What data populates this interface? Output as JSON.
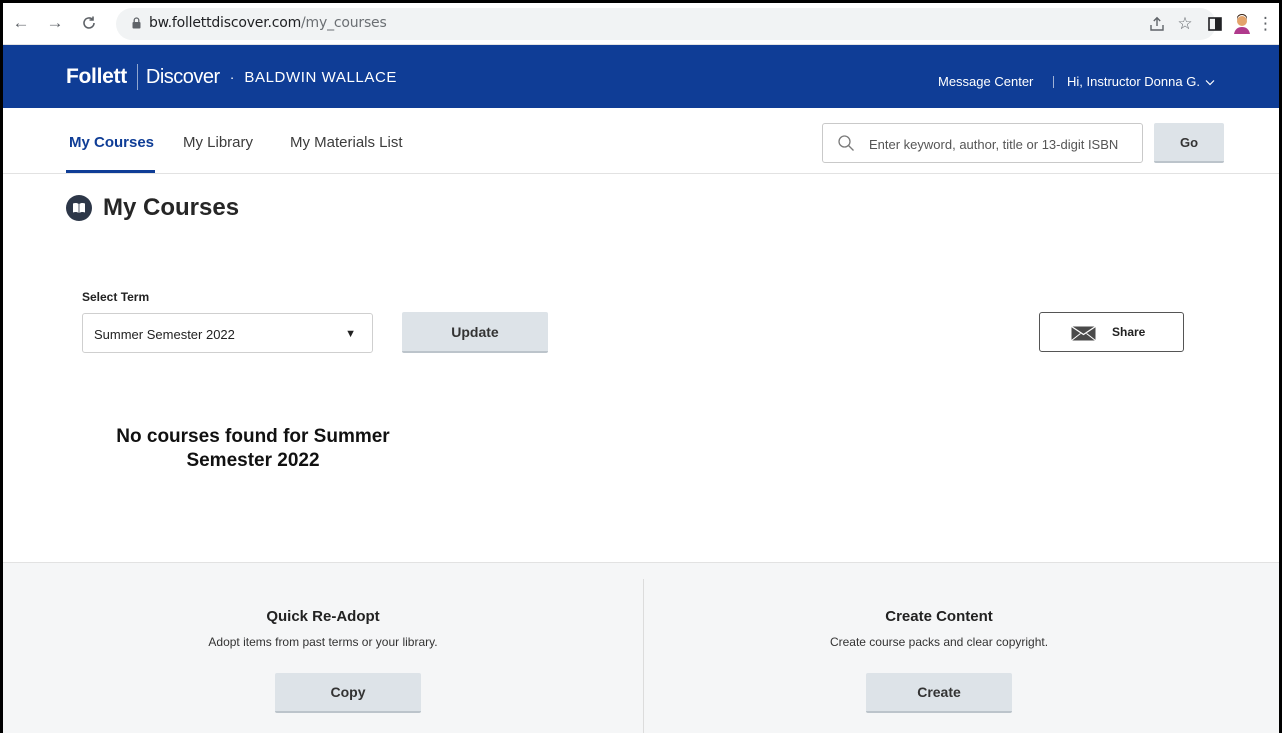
{
  "browser": {
    "url_host": "bw.follettdiscover.com",
    "url_path": "/my_courses",
    "icons": [
      "back-icon",
      "forward-icon",
      "reload-icon",
      "lock-icon",
      "share-icon",
      "star-icon",
      "sidepanel-icon",
      "avatar",
      "menu-icon"
    ]
  },
  "header": {
    "brand_follett": "Follett",
    "brand_discover": "Discover",
    "brand_dot": "·",
    "school": "BALDWIN WALLACE",
    "message_center": "Message Center",
    "greeting": "Hi, Instructor Donna G.",
    "color": "#0f3d96"
  },
  "nav": {
    "tabs": [
      {
        "label": "My Courses",
        "active": true
      },
      {
        "label": "My Library",
        "active": false
      },
      {
        "label": "My Materials List",
        "active": false
      }
    ],
    "search_placeholder": "Enter keyword, author, title or 13-digit ISBN",
    "go_label": "Go"
  },
  "main": {
    "title": "My Courses",
    "select_term_label": "Select Term",
    "selected_term": "Summer Semester 2022",
    "update_label": "Update",
    "share_label": "Share",
    "no_courses_line1": "No courses found for Summer",
    "no_courses_line2": "Semester 2022"
  },
  "footer": {
    "readopt_title": "Quick Re-Adopt",
    "readopt_desc": "Adopt items from past terms or your library.",
    "copy_label": "Copy",
    "create_title": "Create Content",
    "create_desc": "Create course packs and clear copyright.",
    "create_label": "Create"
  }
}
